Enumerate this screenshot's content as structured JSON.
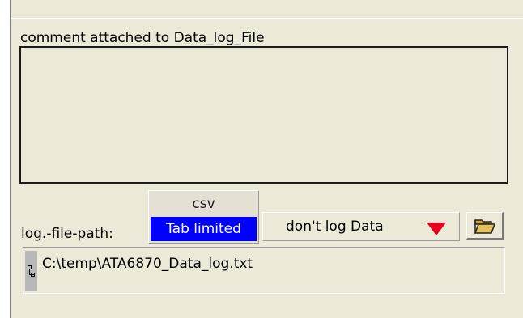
{
  "comment": {
    "label": "comment attached to Data_log_File",
    "value": ""
  },
  "format": {
    "options": [
      "csv",
      "Tab limited"
    ],
    "selected": "Tab limited"
  },
  "log_mode": {
    "selected": "don't log Data",
    "arrow_color": "#e8001c"
  },
  "file_path": {
    "label": "log.-file-path:",
    "value": "C:\\temp\\ATA6870_Data_log.txt"
  },
  "icons": {
    "browse": "folder-open-icon",
    "path_handle": "tree-node-icon"
  },
  "colors": {
    "panel_bg": "#ece9d8",
    "selection": "#0000ff"
  }
}
